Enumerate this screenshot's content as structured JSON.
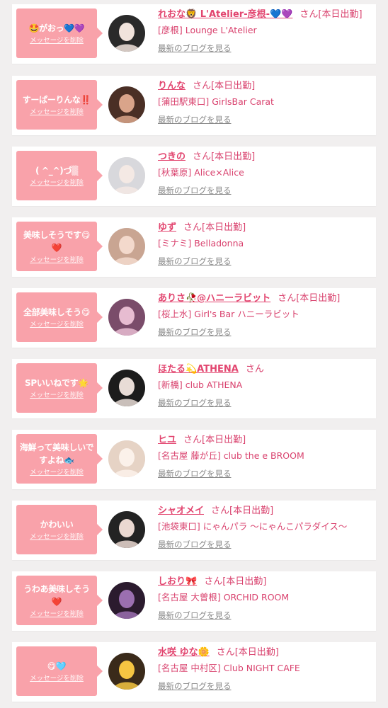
{
  "delete_label": "メッセージを削除",
  "blog_label": "最新のブログを見る",
  "san_label": "さん",
  "entries": [
    {
      "message": "🤩がおっ💙💜",
      "name": "れおな🦁 L'Atelier-彦根-💙💜",
      "status": "[本日出勤]",
      "shop": "[彦根] Lounge L'Atelier",
      "avatar_colors": [
        "#2a2a2a",
        "#f1e3dc"
      ]
    },
    {
      "message": "すーぱーりんな‼️",
      "name": "りんな",
      "status": "[本日出勤]",
      "shop": "[蒲田駅東口] GirlsBar Carat",
      "avatar_colors": [
        "#4a2f25",
        "#d9a48a"
      ]
    },
    {
      "message": "( ^_^)づ▒",
      "name": "つきの",
      "status": "[本日出勤]",
      "shop": "[秋葉原] Alice×Alice",
      "avatar_colors": [
        "#d8d8dc",
        "#f4e9e4"
      ]
    },
    {
      "message": "美味しそうです😋❤️",
      "name": "ゆず",
      "status": "[本日出勤]",
      "shop": "[ミナミ] Belladonna",
      "avatar_colors": [
        "#c9a592",
        "#f3d9cc"
      ]
    },
    {
      "message": "全部美味しそう😋",
      "name": "ありさ🥀@ハニーラビット",
      "status": "[本日出勤]",
      "shop": "[桜上水] Girl's Bar ハニーラビット",
      "avatar_colors": [
        "#7a4c6a",
        "#e7bcd1"
      ]
    },
    {
      "message": "SPいいねです🌟",
      "name": "ほたる💫ATHENA",
      "status": "",
      "shop": "[新橋] club ATHENA",
      "avatar_colors": [
        "#1c1c1c",
        "#e8dcd6"
      ]
    },
    {
      "message": "海鮮って美味しいですよね🐟",
      "name": "ヒユ",
      "status": "[本日出勤]",
      "shop": "[名古屋 藤が丘] club the e BROOM",
      "avatar_colors": [
        "#e6d3c5",
        "#fbf1ea"
      ]
    },
    {
      "message": "かわいい",
      "name": "シャオメイ",
      "status": "[本日出勤]",
      "shop": "[池袋東口] にゃんパラ 〜にゃんこパラダイス〜",
      "avatar_colors": [
        "#232323",
        "#ead8d1"
      ]
    },
    {
      "message": "うわあ美味しそう❤️",
      "name": "しおり🎀",
      "status": "[本日出勤]",
      "shop": "[名古屋 大曽根] ORCHID ROOM",
      "avatar_colors": [
        "#2b1b2e",
        "#9b6fb0"
      ]
    },
    {
      "message": "😋🩵",
      "name": "水咲 ゆな🌼",
      "status": "[本日出勤]",
      "shop": "[名古屋 中村区] Club NIGHT CAFE",
      "avatar_colors": [
        "#3a2a1a",
        "#f5c542"
      ]
    }
  ]
}
